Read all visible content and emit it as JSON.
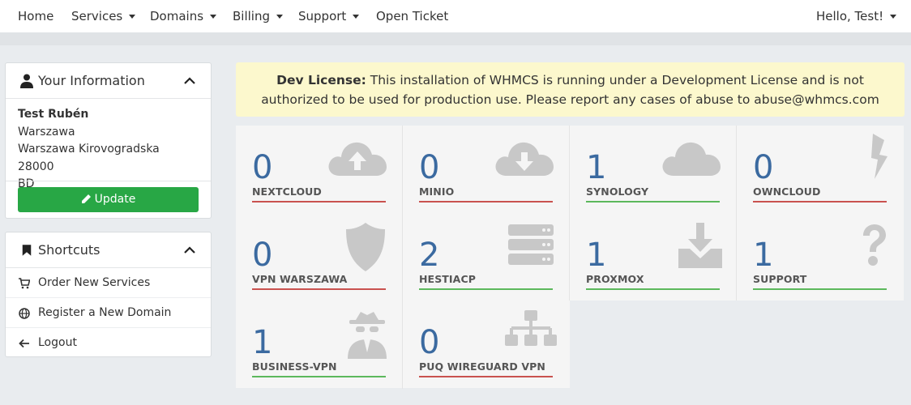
{
  "nav": {
    "home": "Home",
    "services": "Services",
    "domains": "Domains",
    "billing": "Billing",
    "support": "Support",
    "open_ticket": "Open Ticket",
    "greeting": "Hello, Test!"
  },
  "info": {
    "title": "Your Information",
    "name": "Test Rubén",
    "city": "Warszawa",
    "address": "Warszawa Kirovogradska 28000",
    "country": "BD",
    "update_label": "Update"
  },
  "shortcuts": {
    "title": "Shortcuts",
    "items": [
      "Order New Services",
      "Register a New Domain",
      "Logout"
    ]
  },
  "alert": {
    "bold": "Dev License:",
    "line1": "This installation of WHMCS is running under a Development License and is not",
    "line2": "authorized to be used for production use. Please report any cases of abuse to abuse@whmcs.com"
  },
  "tiles": [
    {
      "count": "0",
      "label": "NEXTCLOUD",
      "icon": "cloud-upload-icon",
      "status": "red"
    },
    {
      "count": "0",
      "label": "MINIO",
      "icon": "cloud-download-icon",
      "status": "red"
    },
    {
      "count": "1",
      "label": "SYNOLOGY",
      "icon": "cloud-icon",
      "status": "green"
    },
    {
      "count": "0",
      "label": "OWNCLOUD",
      "icon": "bolt-icon",
      "status": "red"
    },
    {
      "count": "0",
      "label": "VPN WARSZAWA",
      "icon": "shield-icon",
      "status": "red"
    },
    {
      "count": "2",
      "label": "HESTIACP",
      "icon": "server-icon",
      "status": "green"
    },
    {
      "count": "1",
      "label": "PROXMOX",
      "icon": "download-tray-icon",
      "status": "green"
    },
    {
      "count": "1",
      "label": "SUPPORT",
      "icon": "question-icon",
      "status": "green"
    },
    {
      "count": "1",
      "label": "BUSINESS-VPN",
      "icon": "spy-icon",
      "status": "green"
    },
    {
      "count": "0",
      "label": "PUQ WIREGUARD VPN",
      "icon": "sitemap-icon",
      "status": "red"
    }
  ],
  "colors": {
    "accent_green": "#28a745",
    "count_blue": "#3b6aa0",
    "status_red": "#c9524f",
    "status_green": "#5cb85c",
    "alert_bg": "#fcf8cd"
  }
}
